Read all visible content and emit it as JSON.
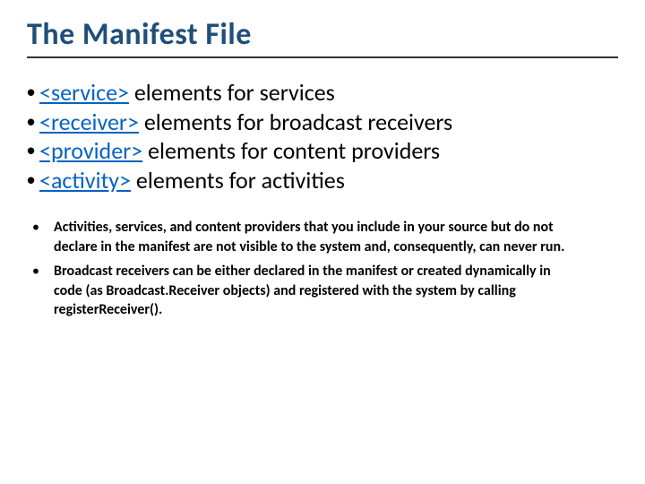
{
  "title": "The Manifest File",
  "main_items": [
    {
      "link": "<service>",
      "rest": " elements for services"
    },
    {
      "link": "<receiver>",
      "rest": " elements for broadcast receivers"
    },
    {
      "link": "<provider>",
      "rest": " elements for content providers"
    },
    {
      "link": "<activity>",
      "rest": " elements for activities"
    }
  ],
  "sub_items": [
    "Activities, services, and content providers that you include in your source but do not declare in the manifest are not visible to the system and, consequently, can never run.",
    "Broadcast receivers can be either declared in the manifest or created dynamically in code (as Broadcast.Receiver objects) and registered with the system by calling registerReceiver()."
  ],
  "bullets": {
    "main": "•",
    "sub": "•"
  }
}
